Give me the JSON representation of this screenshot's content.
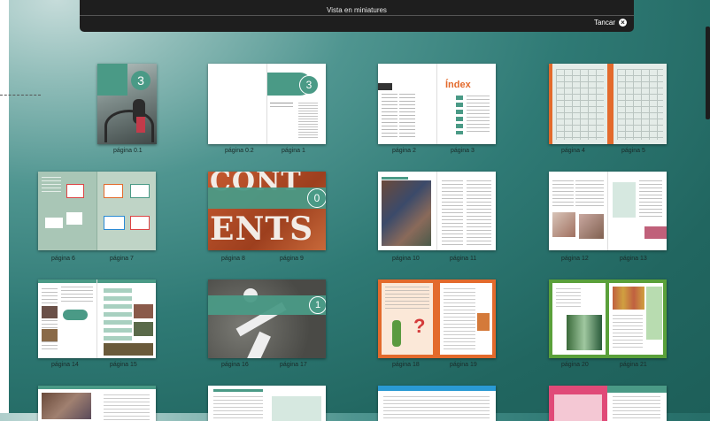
{
  "viewer": {
    "title": "Vista en miniatures",
    "close_label": "Tancar",
    "close_icon": "close-circle-icon"
  },
  "pages": [
    {
      "labels": [
        "página 0.1"
      ]
    },
    {
      "labels": [
        "página 0.2",
        "página 1"
      ],
      "heading": "3"
    },
    {
      "labels": [
        "página 2",
        "página 3"
      ],
      "heading": "Índex"
    },
    {
      "labels": [
        "página 4",
        "página 5"
      ]
    },
    {
      "labels": [
        "página 6",
        "página 7"
      ]
    },
    {
      "labels": [
        "página 8",
        "página 9"
      ],
      "heading": "0",
      "cover_text": [
        "CONT",
        "ENTS"
      ]
    },
    {
      "labels": [
        "página 10",
        "página 11"
      ]
    },
    {
      "labels": [
        "página 12",
        "página 13"
      ]
    },
    {
      "labels": [
        "página 14",
        "página 15"
      ]
    },
    {
      "labels": [
        "página 16",
        "página 17"
      ],
      "heading": "1"
    },
    {
      "labels": [
        "página 18",
        "página 19"
      ]
    },
    {
      "labels": [
        "página 20",
        "página 21"
      ]
    },
    {
      "labels": []
    },
    {
      "labels": []
    },
    {
      "labels": []
    },
    {
      "labels": []
    }
  ],
  "cover_number": "3",
  "colors": {
    "brand_green": "#4a9a86",
    "orange": "#e36a2c",
    "background": "#2f7a75"
  }
}
